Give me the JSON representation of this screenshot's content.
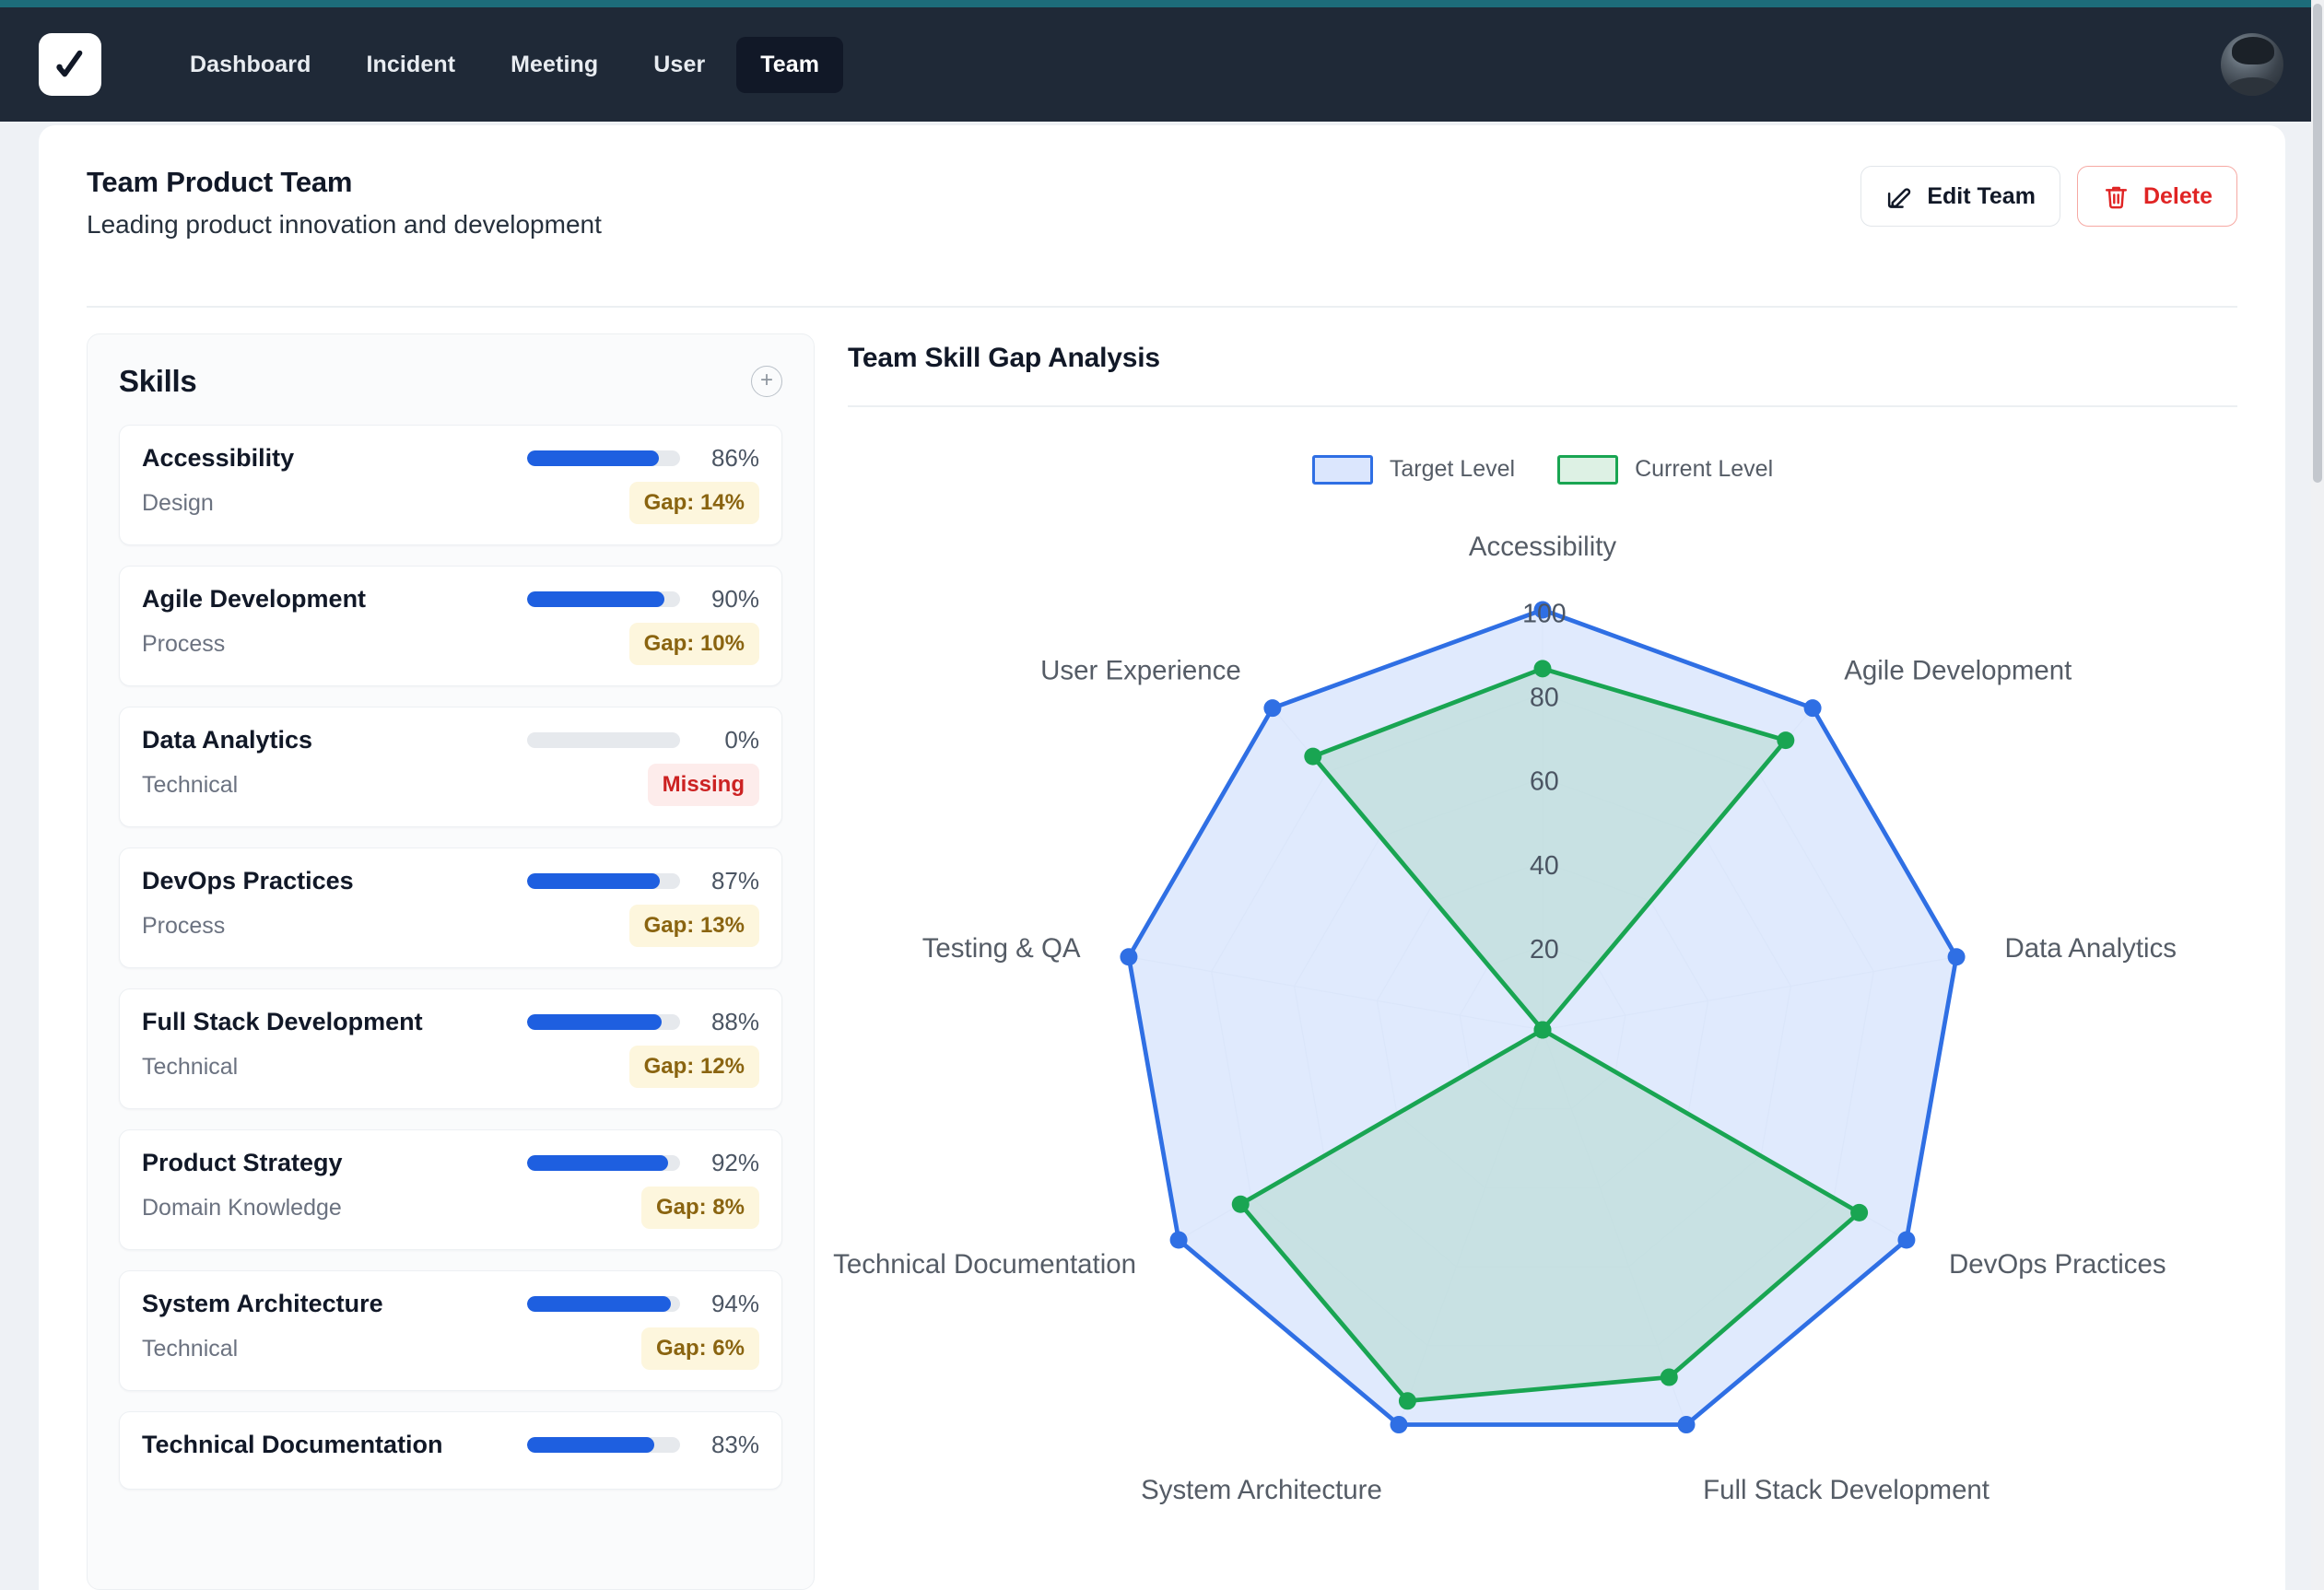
{
  "nav": {
    "logo_icon": "checkmark-logo",
    "links": [
      {
        "label": "Dashboard",
        "active": false
      },
      {
        "label": "Incident",
        "active": false
      },
      {
        "label": "Meeting",
        "active": false
      },
      {
        "label": "User",
        "active": false
      },
      {
        "label": "Team",
        "active": true
      }
    ],
    "avatar_icon": "user-avatar"
  },
  "header": {
    "title": "Team Product Team",
    "subtitle": "Leading product innovation and development",
    "edit_label": "Edit Team",
    "delete_label": "Delete",
    "edit_icon": "pencil-square-icon",
    "delete_icon": "trash-icon"
  },
  "skills_panel": {
    "title": "Skills",
    "add_icon": "plus-circle-icon",
    "items": [
      {
        "name": "Accessibility",
        "category": "Design",
        "percent": "86%",
        "value": 86,
        "badge": "Gap: 14%",
        "badge_type": "gap"
      },
      {
        "name": "Agile Development",
        "category": "Process",
        "percent": "90%",
        "value": 90,
        "badge": "Gap: 10%",
        "badge_type": "gap"
      },
      {
        "name": "Data Analytics",
        "category": "Technical",
        "percent": "0%",
        "value": 0,
        "badge": "Missing",
        "badge_type": "missing"
      },
      {
        "name": "DevOps Practices",
        "category": "Process",
        "percent": "87%",
        "value": 87,
        "badge": "Gap: 13%",
        "badge_type": "gap"
      },
      {
        "name": "Full Stack Development",
        "category": "Technical",
        "percent": "88%",
        "value": 88,
        "badge": "Gap: 12%",
        "badge_type": "gap"
      },
      {
        "name": "Product Strategy",
        "category": "Domain Knowledge",
        "percent": "92%",
        "value": 92,
        "badge": "Gap: 8%",
        "badge_type": "gap"
      },
      {
        "name": "System Architecture",
        "category": "Technical",
        "percent": "94%",
        "value": 94,
        "badge": "Gap: 6%",
        "badge_type": "gap"
      },
      {
        "name": "Technical Documentation",
        "category": "",
        "percent": "83%",
        "value": 83,
        "badge": "",
        "badge_type": "gap"
      }
    ]
  },
  "chart_panel": {
    "title": "Team Skill Gap Analysis"
  },
  "chart_data": {
    "type": "radar",
    "title": "Team Skill Gap Analysis",
    "categories": [
      "Accessibility",
      "Agile Development",
      "Data Analytics",
      "DevOps Practices",
      "Full Stack Development",
      "System Architecture",
      "Technical Documentation",
      "Testing & QA",
      "User Experience"
    ],
    "series": [
      {
        "name": "Target Level",
        "color": "#2f6fe4",
        "fill": "#dbe6fd",
        "values": [
          100,
          100,
          100,
          100,
          100,
          100,
          100,
          100,
          100
        ]
      },
      {
        "name": "Current Level",
        "color": "#19a552",
        "fill": "#b9dbd3",
        "values": [
          86,
          90,
          0,
          87,
          88,
          94,
          83,
          0,
          85
        ]
      }
    ],
    "radial_ticks": [
      20,
      40,
      60,
      80,
      100
    ],
    "rmin": 0,
    "rmax": 100,
    "grid": true,
    "legend_position": "top-center",
    "legend": [
      "Target Level",
      "Current Level"
    ]
  }
}
